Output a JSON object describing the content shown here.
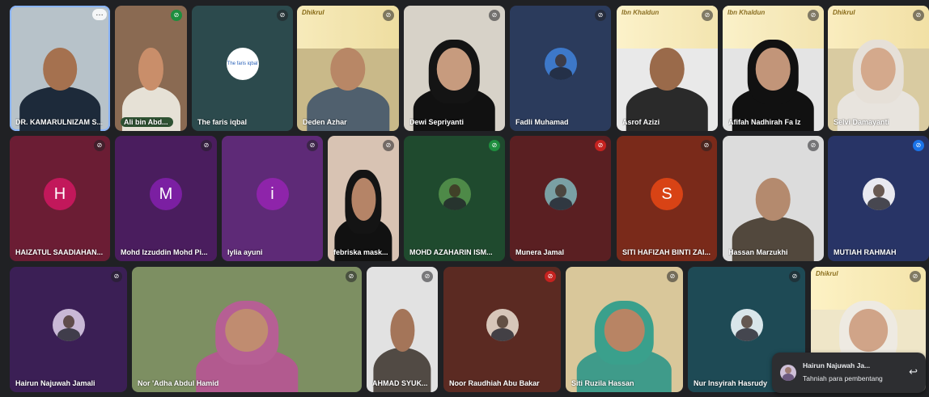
{
  "participants": [
    {
      "name": "DR. KAMARULNIZAM S...",
      "bg": "#b7c2c9",
      "kind": "video",
      "skin": "#a5714f",
      "top": "#1d2a3a"
    },
    {
      "name": "Ali bin Abd...",
      "bg": "#8a6a52",
      "kind": "video",
      "skin": "#c98e6a",
      "top": "#e6e1d6",
      "mic": "green"
    },
    {
      "name": "The faris iqbal",
      "bg": "#2c4a4d",
      "kind": "logo",
      "logo_text": "The faris iqbal"
    },
    {
      "name": "Deden Azhar",
      "bg": "#c9b989",
      "kind": "video",
      "skin": "#b88766",
      "top": "#50606e",
      "banner": "Dhikrul"
    },
    {
      "name": "Dewi Sepriyanti",
      "bg": "#d7d2c8",
      "kind": "video",
      "skin": "#c79b7e",
      "top": "#111",
      "hijab": "#141414"
    },
    {
      "name": "Fadli Muhamad",
      "bg": "#2b3b5c",
      "kind": "photo",
      "avatar_bg": "#3d78c9"
    },
    {
      "name": "Asrof Azizi",
      "bg": "#e9e9e9",
      "kind": "video",
      "skin": "#9a6a4a",
      "top": "#2a2a2a",
      "banner": "Ibn Khaldun"
    },
    {
      "name": "Afifah Nadhirah Fa Iz",
      "bg": "#e4e4e4",
      "kind": "video",
      "skin": "#c29579",
      "top": "#111",
      "hijab": "#111",
      "banner": "Ibn Khaldun"
    },
    {
      "name": "Selvi Damayanti",
      "bg": "#d9cba1",
      "kind": "video",
      "skin": "#d4a98c",
      "top": "#e8e4de",
      "hijab": "#e6e0d8",
      "banner": "Dhikrul"
    },
    {
      "name": "HAIZATUL SAADIAHAN...",
      "bg": "#6b1d34",
      "kind": "letter",
      "letter": "H",
      "avatar_bg": "#c2185b"
    },
    {
      "name": "Mohd Izzuddin Mohd Pi...",
      "bg": "#4a1d5e",
      "kind": "letter",
      "letter": "M",
      "avatar_bg": "#7b1fa2"
    },
    {
      "name": "Iylia ayuni",
      "bg": "#5e2a77",
      "kind": "letter",
      "letter": "i",
      "avatar_bg": "#8e24aa"
    },
    {
      "name": "febriska mask...",
      "bg": "#d8c3b3",
      "kind": "video",
      "skin": "#b58467",
      "top": "#111",
      "hijab": "#141414"
    },
    {
      "name": "MOHD AZAHARIN ISM...",
      "bg": "#1f4a2e",
      "kind": "photo",
      "avatar_bg": "#4e8a48",
      "mic": "green"
    },
    {
      "name": "Munera Jamal",
      "bg": "#5a1f22",
      "kind": "photo",
      "avatar_bg": "#7aa0a4",
      "mic": "red"
    },
    {
      "name": "SITI HAFIZAH BINTI ZAI...",
      "bg": "#7a2a1a",
      "kind": "letter",
      "letter": "S",
      "avatar_bg": "#d84315"
    },
    {
      "name": "Hassan Marzukhi",
      "bg": "#dcdcdc",
      "kind": "video",
      "skin": "#b48a6e",
      "top": "#52483d"
    },
    {
      "name": "MUTIAH RAHMAH",
      "bg": "#283466",
      "kind": "photo",
      "avatar_bg": "#e9e9f0",
      "mic": "blue"
    },
    {
      "name": "Hairun Najuwah Jamali",
      "bg": "#3b1f55",
      "kind": "photo",
      "avatar_bg": "#c9b8d6"
    },
    {
      "name": "Nor 'Adha Abdul Hamid",
      "bg": "#7d8f62",
      "kind": "video",
      "skin": "#c08c70",
      "top": "#b25a8f",
      "hijab": "#b65f94"
    },
    {
      "name": "AHMAD SYUK...",
      "bg": "#e2e2e2",
      "kind": "video",
      "skin": "#a47559",
      "top": "#514a44"
    },
    {
      "name": "Noor Raudhiah Abu Bakar",
      "bg": "#5b2a22",
      "kind": "photo",
      "avatar_bg": "#d7c6b9",
      "mic": "red"
    },
    {
      "name": "Siti Ruzila Hassan",
      "bg": "#d9c79a",
      "kind": "video",
      "skin": "#b88464",
      "top": "#3f9b8a",
      "hijab": "#3aa08c"
    },
    {
      "name": "Nur Insyirah Hasrudy",
      "bg": "#1e4a55",
      "kind": "photo",
      "avatar_bg": "#d9e6ea"
    },
    {
      "name": "",
      "bg": "#efe6c8",
      "kind": "video",
      "skin": "#d0a488",
      "top": "#f0ece6",
      "hijab": "#eeeae2",
      "banner": "Dhikrul"
    }
  ],
  "toast": {
    "name": "Hairun Najuwah Ja...",
    "message": "Tahniah para pembentang",
    "reply_icon": "reply-arrow-icon"
  },
  "colors": {
    "speaking_outline": "#8ab4f8",
    "background": "#202124"
  }
}
